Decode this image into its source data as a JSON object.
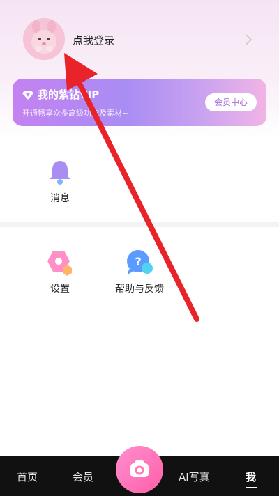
{
  "profile": {
    "login_label": "点我登录"
  },
  "vip": {
    "title": "我的紫钻VIP",
    "subtitle": "开通畅享众多高级功能及素材~",
    "center_button": "会员中心"
  },
  "grid": {
    "messages": {
      "label": "消息",
      "icon": "bell-icon"
    },
    "settings": {
      "label": "设置",
      "icon": "settings-hexagon-icon"
    },
    "help": {
      "label": "帮助与反馈",
      "icon": "help-bubble-icon"
    }
  },
  "bottom_nav": {
    "items": [
      {
        "label": "首页"
      },
      {
        "label": "会员"
      },
      {
        "label": "AI写真"
      },
      {
        "label": "我",
        "active": true
      }
    ],
    "camera_icon": "camera-icon"
  },
  "colors": {
    "accent_purple": "#b98df3",
    "vip_button_text": "#a86ed6",
    "annotation_arrow": "#e8232a",
    "nav_bg": "#111111"
  }
}
